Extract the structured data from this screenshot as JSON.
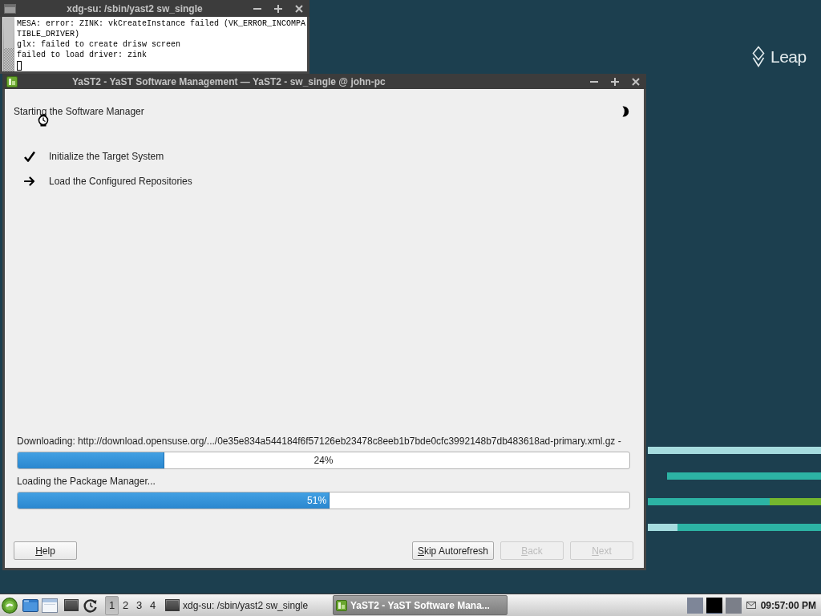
{
  "wallpaper": {
    "logo_text": "Leap"
  },
  "terminal_window": {
    "title": "xdg-su: /sbin/yast2 sw_single",
    "output": [
      "MESA: error: ZINK: vkCreateInstance failed (VK_ERROR_INCOMPATIBLE_DRIVER)",
      "glx: failed to create drisw screen",
      "failed to load driver: zink"
    ]
  },
  "yast_window": {
    "title": "YaST2 - YaST Software Management — YaST2 - sw_single @ john-pc",
    "heading": "Starting the Software Manager",
    "steps": [
      {
        "label": "Initialize the Target System",
        "kind": "done"
      },
      {
        "label": "Load the Configured Repositories",
        "kind": "current"
      }
    ],
    "progress": [
      {
        "label": "Downloading: http://download.opensuse.org/.../0e35e834a544184f6f57126eb23478c8eeb1b7bde0cfc3992148b7db483618ad-primary.xml.gz -",
        "level": 0.24,
        "reading": "24%"
      },
      {
        "label": "Loading the Package Manager...",
        "level": 0.51,
        "reading": "51%"
      }
    ],
    "buttons": [
      {
        "label": "Help",
        "disabled": false
      },
      {
        "label": "Skip Autorefresh",
        "disabled": false
      },
      {
        "label": "Back",
        "disabled": true
      },
      {
        "label": "Next",
        "disabled": true
      }
    ]
  },
  "taskbar": {
    "workspaces": [
      {
        "label": "1",
        "selected": true
      },
      {
        "label": "2",
        "selected": false
      },
      {
        "label": "3",
        "selected": false
      },
      {
        "label": "4",
        "selected": false
      }
    ],
    "tasks": [
      {
        "title": "xdg-su: /sbin/yast2 sw_single",
        "kind": "terminal",
        "selected": false
      },
      {
        "title": "YaST2 - YaST Software Mana...",
        "kind": "yast",
        "selected": true
      }
    ],
    "clock": "09:57:00 PM"
  }
}
